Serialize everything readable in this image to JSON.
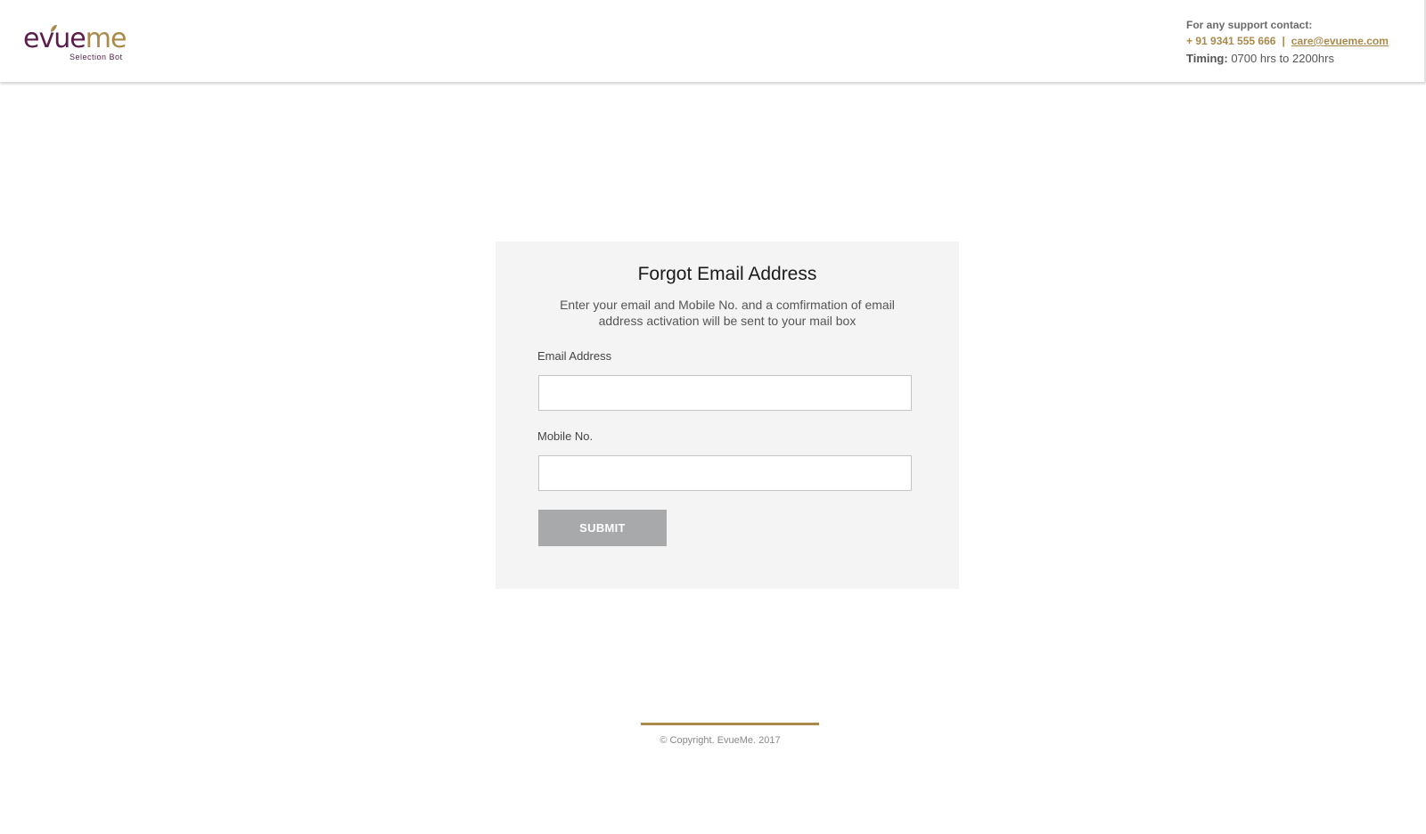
{
  "brand": {
    "logo_part1": "e",
    "logo_part2": "v",
    "logo_part3": "ue",
    "logo_part4": "me",
    "logo_subtitle": "Selection Bot",
    "primary_color": "#5b1e4b",
    "accent_color": "#a98a4c"
  },
  "support": {
    "title": "For any support contact:",
    "phone": "+ 91 9341 555 666",
    "separator": "|",
    "email": "care@evueme.com",
    "timing_label": "Timing:",
    "timing_value": "0700 hrs to  2200hrs"
  },
  "form": {
    "title": "Forgot Email Address",
    "description": "Enter your email  and Mobile No. and a comfirmation of email address activation will be sent to your mail box",
    "email_label": "Email Address",
    "email_value": "",
    "mobile_label": "Mobile No.",
    "mobile_value": "",
    "submit_label": "SUBMIT",
    "submit_color": "#a7a9ab"
  },
  "footer": {
    "copyright": "© Copyright. EvueMe. 2017"
  }
}
